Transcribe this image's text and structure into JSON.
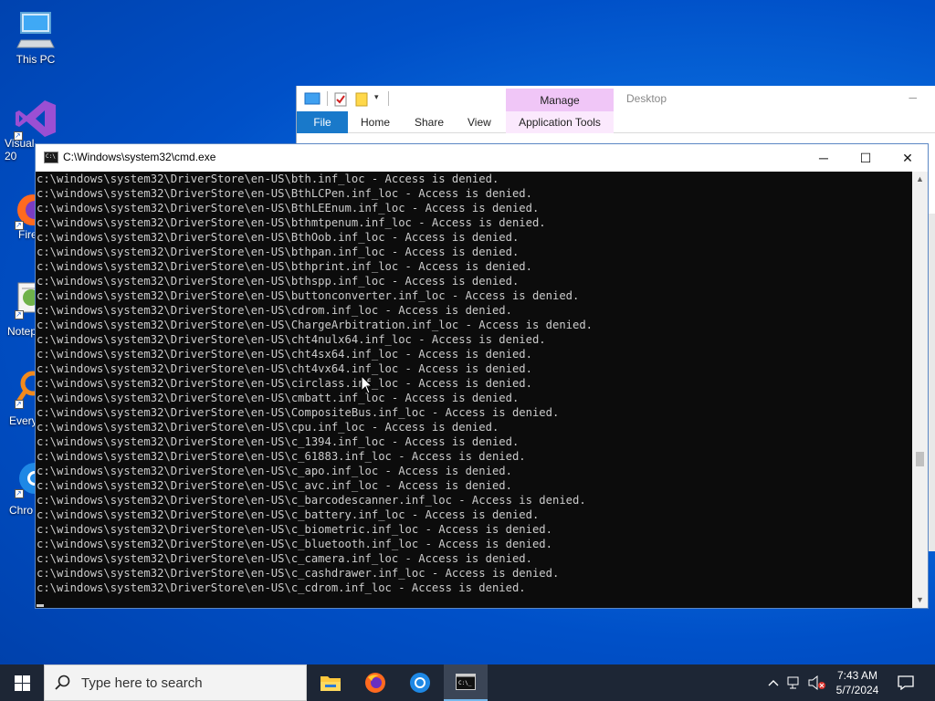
{
  "desktop": {
    "icons": [
      {
        "label": "This PC",
        "icon": "computer-icon"
      },
      {
        "label": "Visual\n20",
        "icon": "visual-studio-icon"
      },
      {
        "label": "Fire",
        "icon": "firefox-icon"
      },
      {
        "label": "Notep",
        "icon": "notepad-icon"
      },
      {
        "label": "Every",
        "icon": "everything-icon"
      },
      {
        "label": "Chro",
        "icon": "chrome-icon"
      }
    ]
  },
  "explorer": {
    "manage_label": "Manage",
    "window_title": "Desktop",
    "tabs": {
      "file": "File",
      "home": "Home",
      "share": "Share",
      "view": "View",
      "app_tools": "Application Tools"
    }
  },
  "cmd": {
    "title": "C:\\Windows\\system32\\cmd.exe",
    "controls": {
      "minimize": "─",
      "maximize": "☐",
      "close": "✕"
    },
    "lines": [
      "c:\\windows\\system32\\DriverStore\\en-US\\bth.inf_loc - Access is denied.",
      "c:\\windows\\system32\\DriverStore\\en-US\\BthLCPen.inf_loc - Access is denied.",
      "c:\\windows\\system32\\DriverStore\\en-US\\BthLEEnum.inf_loc - Access is denied.",
      "c:\\windows\\system32\\DriverStore\\en-US\\bthmtpenum.inf_loc - Access is denied.",
      "c:\\windows\\system32\\DriverStore\\en-US\\BthOob.inf_loc - Access is denied.",
      "c:\\windows\\system32\\DriverStore\\en-US\\bthpan.inf_loc - Access is denied.",
      "c:\\windows\\system32\\DriverStore\\en-US\\bthprint.inf_loc - Access is denied.",
      "c:\\windows\\system32\\DriverStore\\en-US\\bthspp.inf_loc - Access is denied.",
      "c:\\windows\\system32\\DriverStore\\en-US\\buttonconverter.inf_loc - Access is denied.",
      "c:\\windows\\system32\\DriverStore\\en-US\\cdrom.inf_loc - Access is denied.",
      "c:\\windows\\system32\\DriverStore\\en-US\\ChargeArbitration.inf_loc - Access is denied.",
      "c:\\windows\\system32\\DriverStore\\en-US\\cht4nulx64.inf_loc - Access is denied.",
      "c:\\windows\\system32\\DriverStore\\en-US\\cht4sx64.inf_loc - Access is denied.",
      "c:\\windows\\system32\\DriverStore\\en-US\\cht4vx64.inf_loc - Access is denied.",
      "c:\\windows\\system32\\DriverStore\\en-US\\circlass.inf_loc - Access is denied.",
      "c:\\windows\\system32\\DriverStore\\en-US\\cmbatt.inf_loc - Access is denied.",
      "c:\\windows\\system32\\DriverStore\\en-US\\CompositeBus.inf_loc - Access is denied.",
      "c:\\windows\\system32\\DriverStore\\en-US\\cpu.inf_loc - Access is denied.",
      "c:\\windows\\system32\\DriverStore\\en-US\\c_1394.inf_loc - Access is denied.",
      "c:\\windows\\system32\\DriverStore\\en-US\\c_61883.inf_loc - Access is denied.",
      "c:\\windows\\system32\\DriverStore\\en-US\\c_apo.inf_loc - Access is denied.",
      "c:\\windows\\system32\\DriverStore\\en-US\\c_avc.inf_loc - Access is denied.",
      "c:\\windows\\system32\\DriverStore\\en-US\\c_barcodescanner.inf_loc - Access is denied.",
      "c:\\windows\\system32\\DriverStore\\en-US\\c_battery.inf_loc - Access is denied.",
      "c:\\windows\\system32\\DriverStore\\en-US\\c_biometric.inf_loc - Access is denied.",
      "c:\\windows\\system32\\DriverStore\\en-US\\c_bluetooth.inf_loc - Access is denied.",
      "c:\\windows\\system32\\DriverStore\\en-US\\c_camera.inf_loc - Access is denied.",
      "c:\\windows\\system32\\DriverStore\\en-US\\c_cashdrawer.inf_loc - Access is denied.",
      "c:\\windows\\system32\\DriverStore\\en-US\\c_cdrom.inf_loc - Access is denied."
    ]
  },
  "taskbar": {
    "search_placeholder": "Type here to search",
    "apps": [
      {
        "name": "file-explorer",
        "icon": "folder-icon",
        "active": false
      },
      {
        "name": "firefox",
        "icon": "firefox-icon",
        "active": false
      },
      {
        "name": "chrome",
        "icon": "chrome-icon",
        "active": false
      },
      {
        "name": "cmd",
        "icon": "terminal-icon",
        "active": true
      }
    ],
    "clock": {
      "time": "7:43 AM",
      "date": "5/7/2024"
    }
  }
}
